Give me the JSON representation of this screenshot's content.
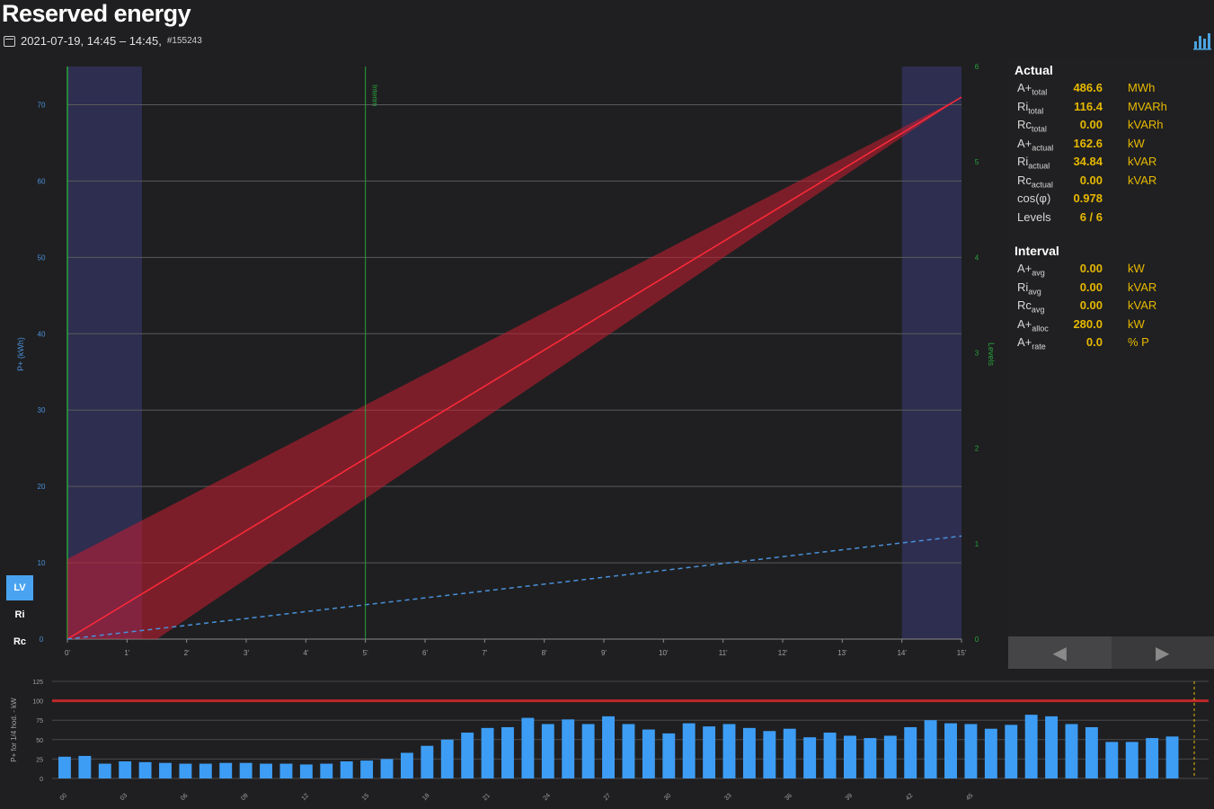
{
  "header": {
    "title": "Reserved energy",
    "subtitle": "2021-07-19, 14:45 – 14:45,",
    "id": "#155243"
  },
  "icons": {
    "calendar": "calendar-icon",
    "chart": "bar-chart-icon"
  },
  "colors": {
    "background": "#1f1f21",
    "band": "#c81e32",
    "trend": "#ff2a3a",
    "forecast": "#4a90d9",
    "highlight": "#2e2e50",
    "marker": "#27a33a",
    "bars": "#3d9df5",
    "limit": "#c0282a",
    "value": "#e6b800"
  },
  "chart_data": [
    {
      "type": "line",
      "ylabel": "P+ (kWh)",
      "y2label": "Levels",
      "ylim": [
        0,
        75
      ],
      "y2lim": [
        0,
        6
      ],
      "yticks": [
        "0",
        "10",
        "20",
        "30",
        "40",
        "50",
        "60",
        "70"
      ],
      "y2ticks": [
        "0",
        "1",
        "2",
        "3",
        "4",
        "5",
        "6"
      ],
      "xticks": [
        "0'",
        "1'",
        "2'",
        "3'",
        "4'",
        "5'",
        "6'",
        "7'",
        "8'",
        "9'",
        "10'",
        "11'",
        "12'",
        "13'",
        "14'",
        "15'"
      ],
      "xlim": [
        0,
        15
      ],
      "marker": {
        "x": 5,
        "label": "Interim"
      },
      "highlight_ranges": [
        [
          0,
          1.25
        ],
        [
          14,
          15
        ]
      ],
      "trend": {
        "x": [
          0,
          15
        ],
        "y": [
          0,
          71
        ]
      },
      "band": {
        "upper": [
          [
            0,
            10.5
          ],
          [
            15,
            71
          ]
        ],
        "lower": [
          [
            1.5,
            0
          ],
          [
            15,
            71
          ]
        ]
      },
      "forecast": {
        "x": [
          0,
          15
        ],
        "y": [
          0,
          13.5
        ]
      }
    },
    {
      "type": "bar",
      "ylabel": "P+ for 1/4 hod. - kW",
      "ylim": [
        0,
        125
      ],
      "yticks": [
        "0",
        "25",
        "50",
        "75",
        "100",
        "125"
      ],
      "limit": 100,
      "xticks": [
        "00",
        "03",
        "06",
        "09",
        "12",
        "15",
        "18",
        "21",
        "24",
        "27",
        "30",
        "33",
        "36",
        "39",
        "42",
        "45"
      ],
      "values": [
        28,
        29,
        19,
        22,
        21,
        20,
        19,
        19,
        20,
        20,
        19,
        19,
        18,
        19,
        22,
        23,
        25,
        33,
        42,
        50,
        59,
        65,
        66,
        78,
        70,
        76,
        70,
        80,
        70,
        63,
        58,
        71,
        67,
        70,
        65,
        61,
        64,
        53,
        59,
        55,
        52,
        55,
        66,
        75,
        71,
        70,
        64,
        69,
        82,
        80,
        70,
        66,
        47,
        47,
        52,
        54
      ]
    }
  ],
  "toggles": [
    {
      "label": "LV",
      "active": true
    },
    {
      "label": "Ri",
      "active": false
    },
    {
      "label": "Rc",
      "active": false
    }
  ],
  "panel": {
    "actual_title": "Actual",
    "actual": [
      {
        "label": "A+",
        "sub": "total",
        "value": "486.6",
        "unit": "MWh"
      },
      {
        "label": "Ri",
        "sub": "total",
        "value": "116.4",
        "unit": "MVARh"
      },
      {
        "label": "Rc",
        "sub": "total",
        "value": "0.00",
        "unit": "kVARh"
      },
      {
        "label": "A+",
        "sub": "actual",
        "value": "162.6",
        "unit": "kW"
      },
      {
        "label": "Ri",
        "sub": "actual",
        "value": "34.84",
        "unit": "kVAR"
      },
      {
        "label": "Rc",
        "sub": "actual",
        "value": "0.00",
        "unit": "kVAR"
      },
      {
        "label": "cos(φ)",
        "sub": "",
        "value": "0.978",
        "unit": ""
      },
      {
        "label": "Levels",
        "sub": "",
        "value": "6 / 6",
        "unit": ""
      }
    ],
    "interval_title": "Interval",
    "interval": [
      {
        "label": "A+",
        "sub": "avg",
        "value": "0.00",
        "unit": "kW"
      },
      {
        "label": "Ri",
        "sub": "avg",
        "value": "0.00",
        "unit": "kVAR"
      },
      {
        "label": "Rc",
        "sub": "avg",
        "value": "0.00",
        "unit": "kVAR"
      },
      {
        "label": "A+",
        "sub": "alloc",
        "value": "280.0",
        "unit": "kW"
      },
      {
        "label": "A+",
        "sub": "rate",
        "value": "0.0",
        "unit": "% P"
      }
    ]
  }
}
